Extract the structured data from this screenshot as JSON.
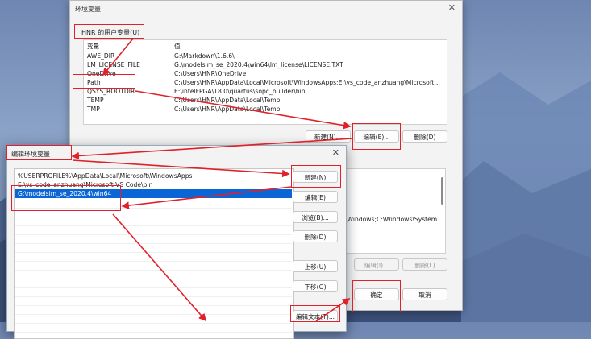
{
  "env_dialog": {
    "title": "环境变量",
    "close_glyph": "✕",
    "user_vars_label": "HNR 的用户变量(U)",
    "table": {
      "headers": [
        "变量",
        "值"
      ],
      "rows": [
        {
          "name": "AWE_DIR",
          "value": "G:\\Markdown\\1.6.6\\"
        },
        {
          "name": "LM_LICENSE_FILE",
          "value": "G:\\modelsim_se_2020.4\\win64\\lm_license\\LICENSE.TXT"
        },
        {
          "name": "OneDrive",
          "value": "C:\\Users\\HNR\\OneDrive"
        },
        {
          "name": "Path",
          "value": "C:\\Users\\HNR\\AppData\\Local\\Microsoft\\WindowsApps;E:\\vs_code_anzhuang\\Microsoft VS Co..."
        },
        {
          "name": "QSYS_ROOTDIR",
          "value": "E:\\intelFPGA\\18.0\\quartus\\sopc_builder\\bin"
        },
        {
          "name": "TEMP",
          "value": "C:\\Users\\HNR\\AppData\\Local\\Temp"
        },
        {
          "name": "TMP",
          "value": "C:\\Users\\HNR\\AppData\\Local\\Temp"
        }
      ]
    },
    "buttons": {
      "new": "新建(N)...",
      "edit": "编辑(E)...",
      "delete": "删除(D)",
      "sys_edit": "编辑(I)...",
      "sys_delete": "删除(L)",
      "ok": "确定",
      "cancel": "取消"
    },
    "system_value_fragment": "\\Windows;C:\\Windows\\System..."
  },
  "edit_dialog": {
    "title": "编辑环境变量",
    "close_glyph": "✕",
    "paths": [
      "%USERPROFILE%\\AppData\\Local\\Microsoft\\WindowsApps",
      "E:\\vs_code_anzhuang\\Microsoft VS Code\\bin",
      "G:\\modelsim_se_2020.4\\win64"
    ],
    "selected_index": 2,
    "buttons": {
      "new": "新建(N)",
      "edit": "编辑(E)",
      "browse": "浏览(B)...",
      "delete": "删除(D)",
      "move_up": "上移(U)",
      "move_down": "下移(O)",
      "edit_text": "编辑文本(T)..."
    }
  },
  "colors": {
    "annotation": "#e0202a",
    "selection": "#0a66d6",
    "title_bar_active": "#ffffff"
  }
}
